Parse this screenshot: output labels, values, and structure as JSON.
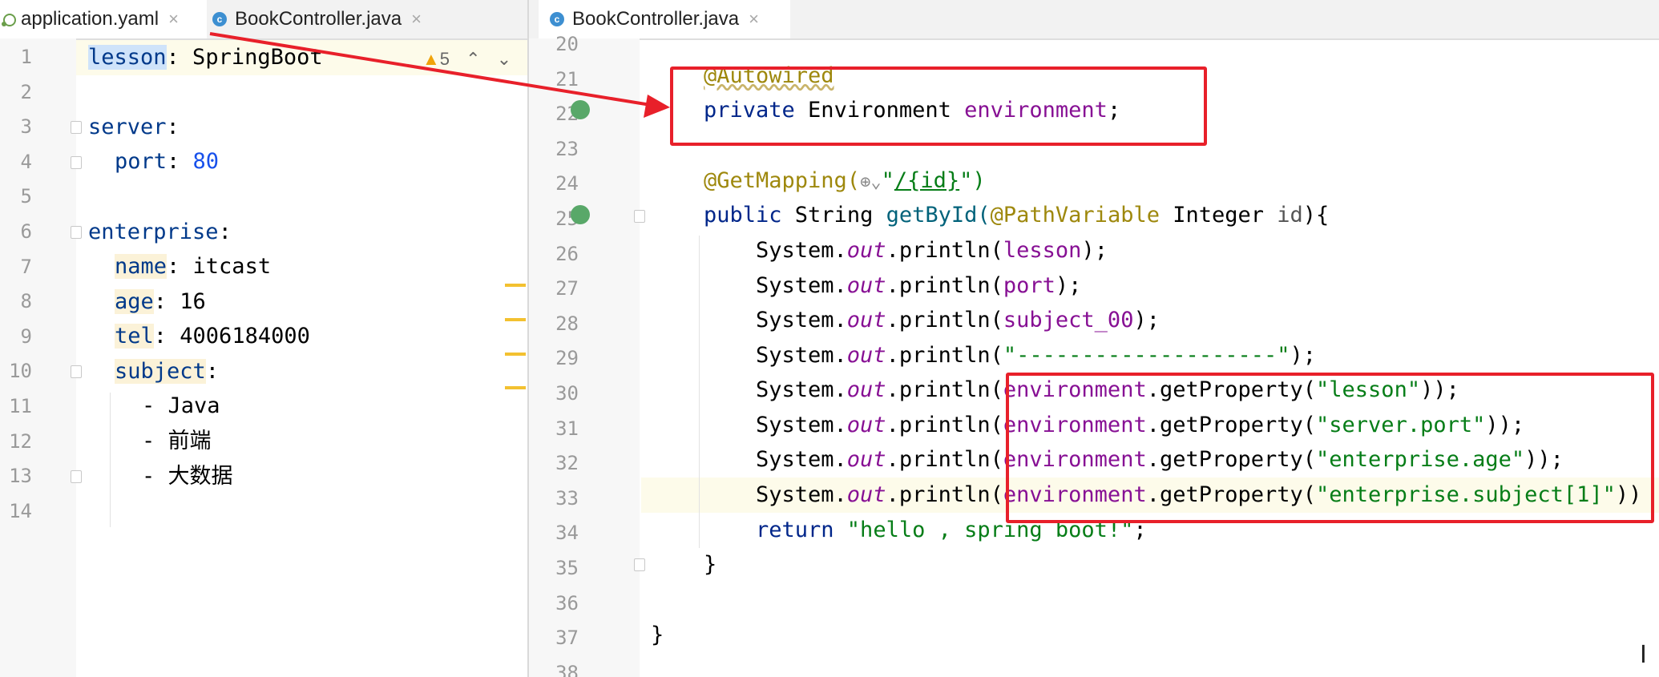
{
  "left_tabs": [
    {
      "label": "application.yaml",
      "close": "×"
    },
    {
      "label": "BookController.java",
      "close": "×"
    }
  ],
  "right_tabs": [
    {
      "label": "BookController.java",
      "close": "×"
    }
  ],
  "left_editor": {
    "warning_count": "5",
    "line_numbers": [
      "1",
      "2",
      "3",
      "4",
      "5",
      "6",
      "7",
      "8",
      "9",
      "10",
      "11",
      "12",
      "13",
      "14"
    ],
    "lines": {
      "l1_key": "lesson",
      "l1_rest": ": SpringBoot",
      "l3_key": "server",
      "l3_rest": ":",
      "l4_key": "port",
      "l4_colon": ": ",
      "l4_val": "80",
      "l6_key": "enterprise",
      "l6_rest": ":",
      "l7_key": "name",
      "l7_rest": ": itcast",
      "l8_key": "age",
      "l8_rest": ": 16",
      "l9_key": "tel",
      "l9_rest": ": 4006184000",
      "l10_key": "subject",
      "l10_rest": ":",
      "l11": "- Java",
      "l12": "- 前端",
      "l13": "- 大数据"
    }
  },
  "right_editor": {
    "line_numbers": [
      "20",
      "21",
      "22",
      "23",
      "24",
      "25",
      "26",
      "27",
      "28",
      "29",
      "30",
      "31",
      "32",
      "33",
      "34",
      "35",
      "36",
      "37",
      "38"
    ],
    "tokens": {
      "autowired": "@Autowired",
      "private": "private",
      "environment_type": " Environment ",
      "environment_field": "environment",
      "semicolon": ";",
      "getmapping": "@GetMapping(",
      "mapping_icon": "⊕⌄",
      "mapping_quote1": "\"",
      "mapping_path": "/{id}",
      "mapping_end": "\")",
      "public": "public",
      "string_type": " String ",
      "method": "getById(",
      "pathvariable": "@PathVariable",
      "integer_type": " Integer ",
      "id_param": "id",
      "method_end": "){",
      "system": "System.",
      "out": "out",
      "println": ".println(",
      "lesson_var": "lesson",
      "port_var": "port",
      "subject_var": "subject_00",
      "close_stmt": ");",
      "dashes": "\"--------------------\"",
      "get_property": ".getProperty(",
      "prop_lesson": "\"lesson\"",
      "prop_port": "\"server.port\"",
      "prop_age": "\"enterprise.age\"",
      "prop_subject": "\"enterprise.subject[1]\"",
      "close2": "));",
      "close_trunc": "))",
      "return_kw": "return",
      "hello_str": " \"hello , spring boot!\"",
      "close_brace": "}"
    }
  },
  "colors": {
    "annotation_box": "#e8202a",
    "yaml_key": "#00398a",
    "string": "#067d17",
    "field": "#871094",
    "annotation": "#9e880d",
    "change_marker": "#f3c130"
  }
}
